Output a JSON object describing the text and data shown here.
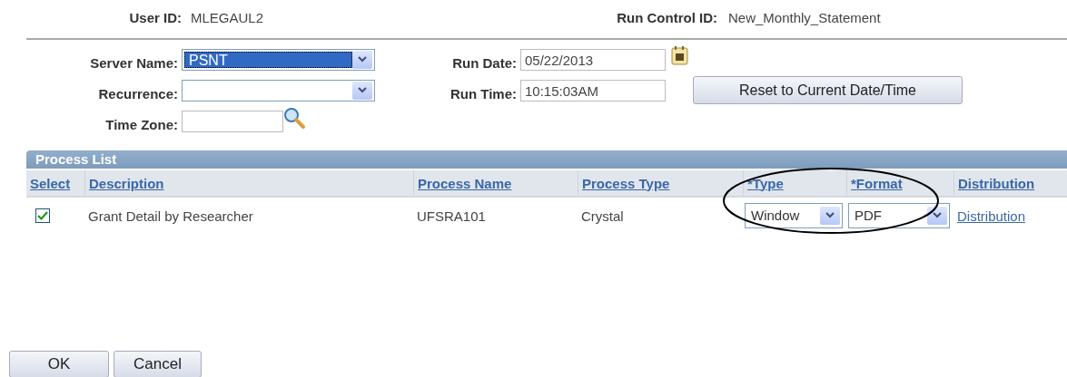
{
  "header": {
    "user_id_label": "User ID:",
    "user_id": "MLEGAUL2",
    "run_control_label": "Run Control ID:",
    "run_control_id": "New_Monthly_Statement"
  },
  "form": {
    "server_name_label": "Server Name:",
    "server_name": "PSNT",
    "recurrence_label": "Recurrence:",
    "time_zone_label": "Time Zone:",
    "run_date_label": "Run Date:",
    "run_date": "05/22/2013",
    "run_time_label": "Run Time:",
    "run_time": "10:15:03AM",
    "reset_button": "Reset to Current Date/Time"
  },
  "process_list": {
    "title": "Process List",
    "columns": [
      "Select",
      "Description",
      "Process Name",
      "Process Type",
      "*Type",
      "*Format",
      "Distribution"
    ],
    "rows": [
      {
        "checked": true,
        "description": "Grant Detail by Researcher",
        "process_name": "UFSRA101",
        "process_type": "Crystal",
        "type": "Window",
        "format": "PDF",
        "distribution": "Distribution"
      }
    ],
    "highlight_annotation": true
  },
  "buttons": [
    "OK",
    "Cancel"
  ]
}
